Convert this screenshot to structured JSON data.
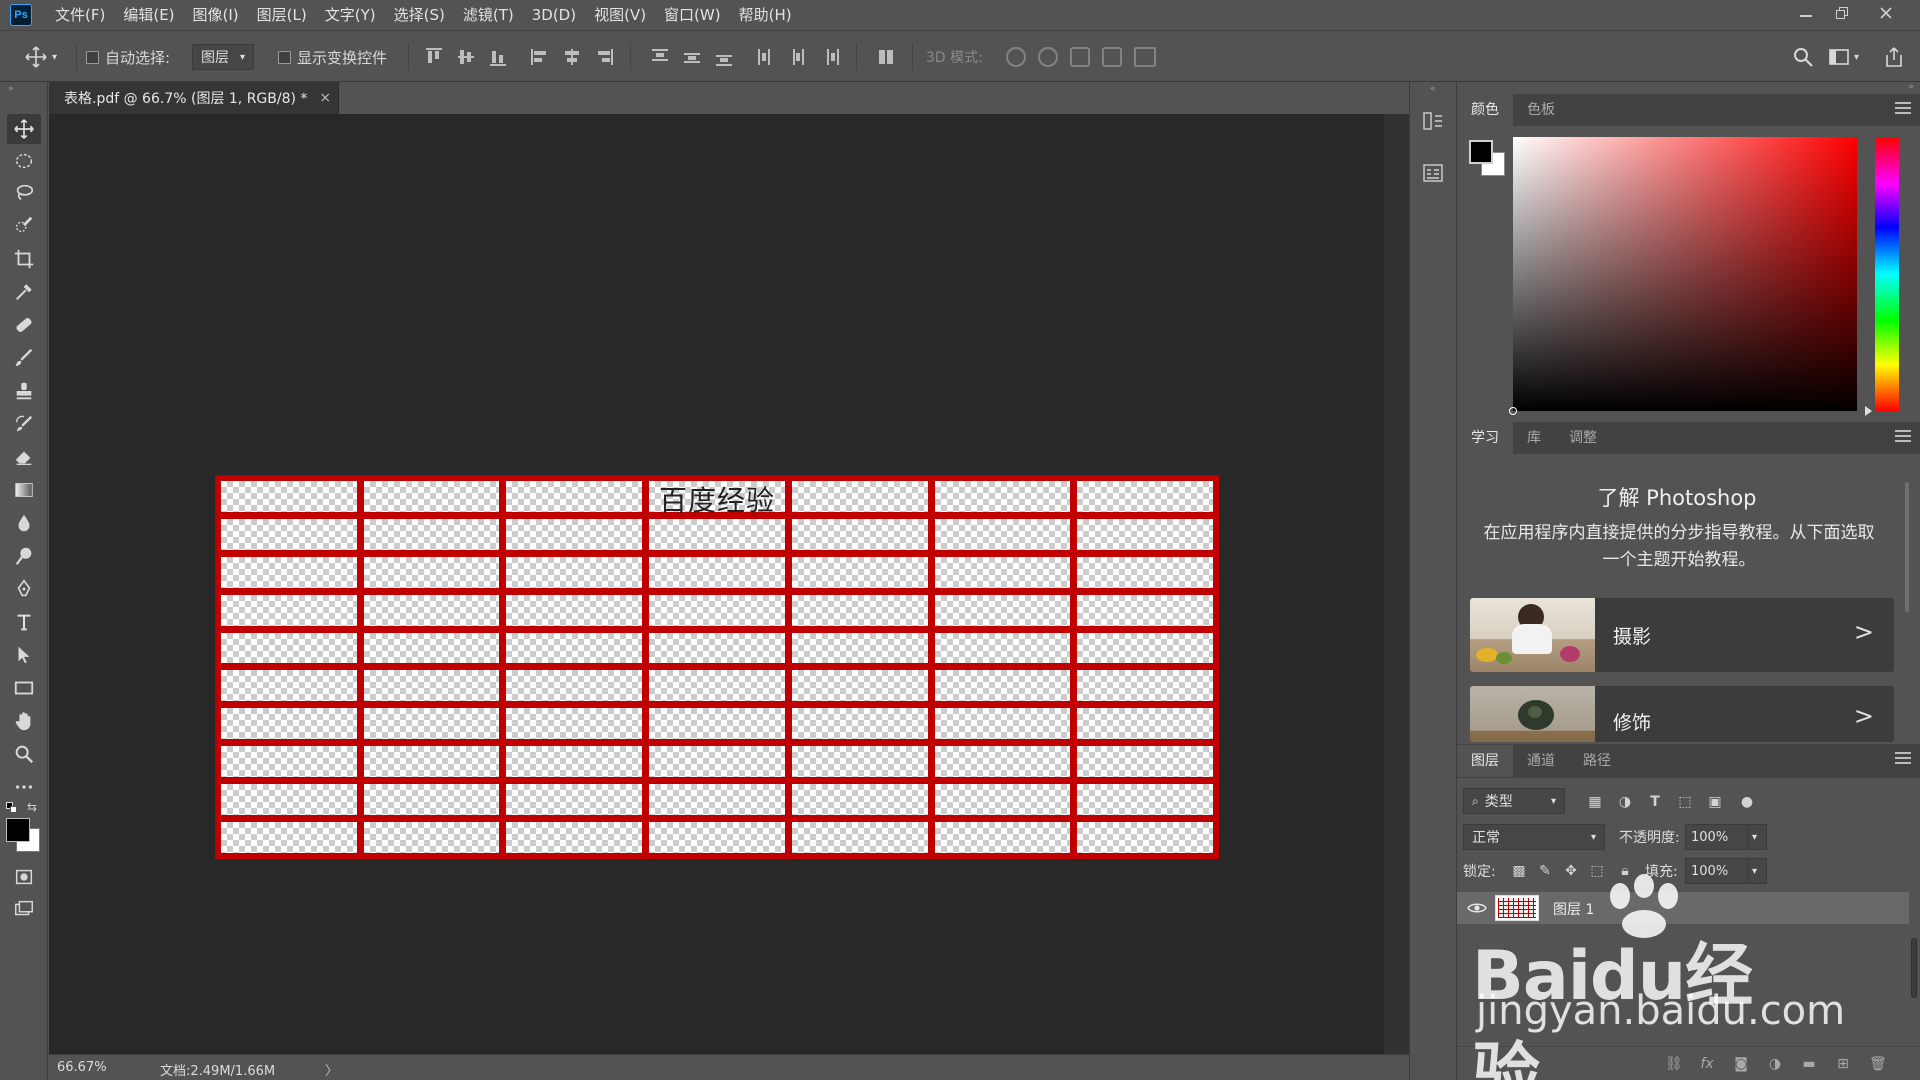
{
  "app": {
    "logo": "Ps"
  },
  "menu": [
    "文件(F)",
    "编辑(E)",
    "图像(I)",
    "图层(L)",
    "文字(Y)",
    "选择(S)",
    "滤镜(T)",
    "3D(D)",
    "视图(V)",
    "窗口(W)",
    "帮助(H)"
  ],
  "options": {
    "auto_select_label": "自动选择:",
    "auto_select_value": "图层",
    "show_transform_label": "显示变换控件",
    "mode3d_label": "3D 模式:"
  },
  "document": {
    "tab_title": "表格.pdf @ 66.7% (图层 1, RGB/8) *",
    "close": "×",
    "table_title": "百度经验",
    "table_rows": 10,
    "table_cols": 7,
    "border_color": "#c00000"
  },
  "status": {
    "zoom": "66.67%",
    "doc_info": "文档:2.49M/1.66M",
    "arrow": "〉"
  },
  "color_panel": {
    "tabs": [
      "颜色",
      "色板"
    ],
    "foreground": "#000000",
    "background": "#ffffff"
  },
  "learn_panel": {
    "tabs": [
      "学习",
      "库",
      "调整"
    ],
    "title": "了解 Photoshop",
    "description": "在应用程序内直接提供的分步指导教程。从下面选取一个主题开始教程。",
    "cards": [
      {
        "label": "摄影",
        "chevron": ">"
      },
      {
        "label": "修饰",
        "chevron": ">"
      }
    ]
  },
  "layers_panel": {
    "tabs": [
      "图层",
      "通道",
      "路径"
    ],
    "filter_label": "类型",
    "blend_mode": "正常",
    "opacity_label": "不透明度:",
    "opacity_value": "100%",
    "lock_label": "锁定:",
    "fill_label": "填充:",
    "fill_value": "100%",
    "layers": [
      {
        "name": "图层 1",
        "visible": true
      }
    ]
  },
  "watermark": {
    "brand": "Baidu经验",
    "url": "jingyan.baidu.com"
  }
}
